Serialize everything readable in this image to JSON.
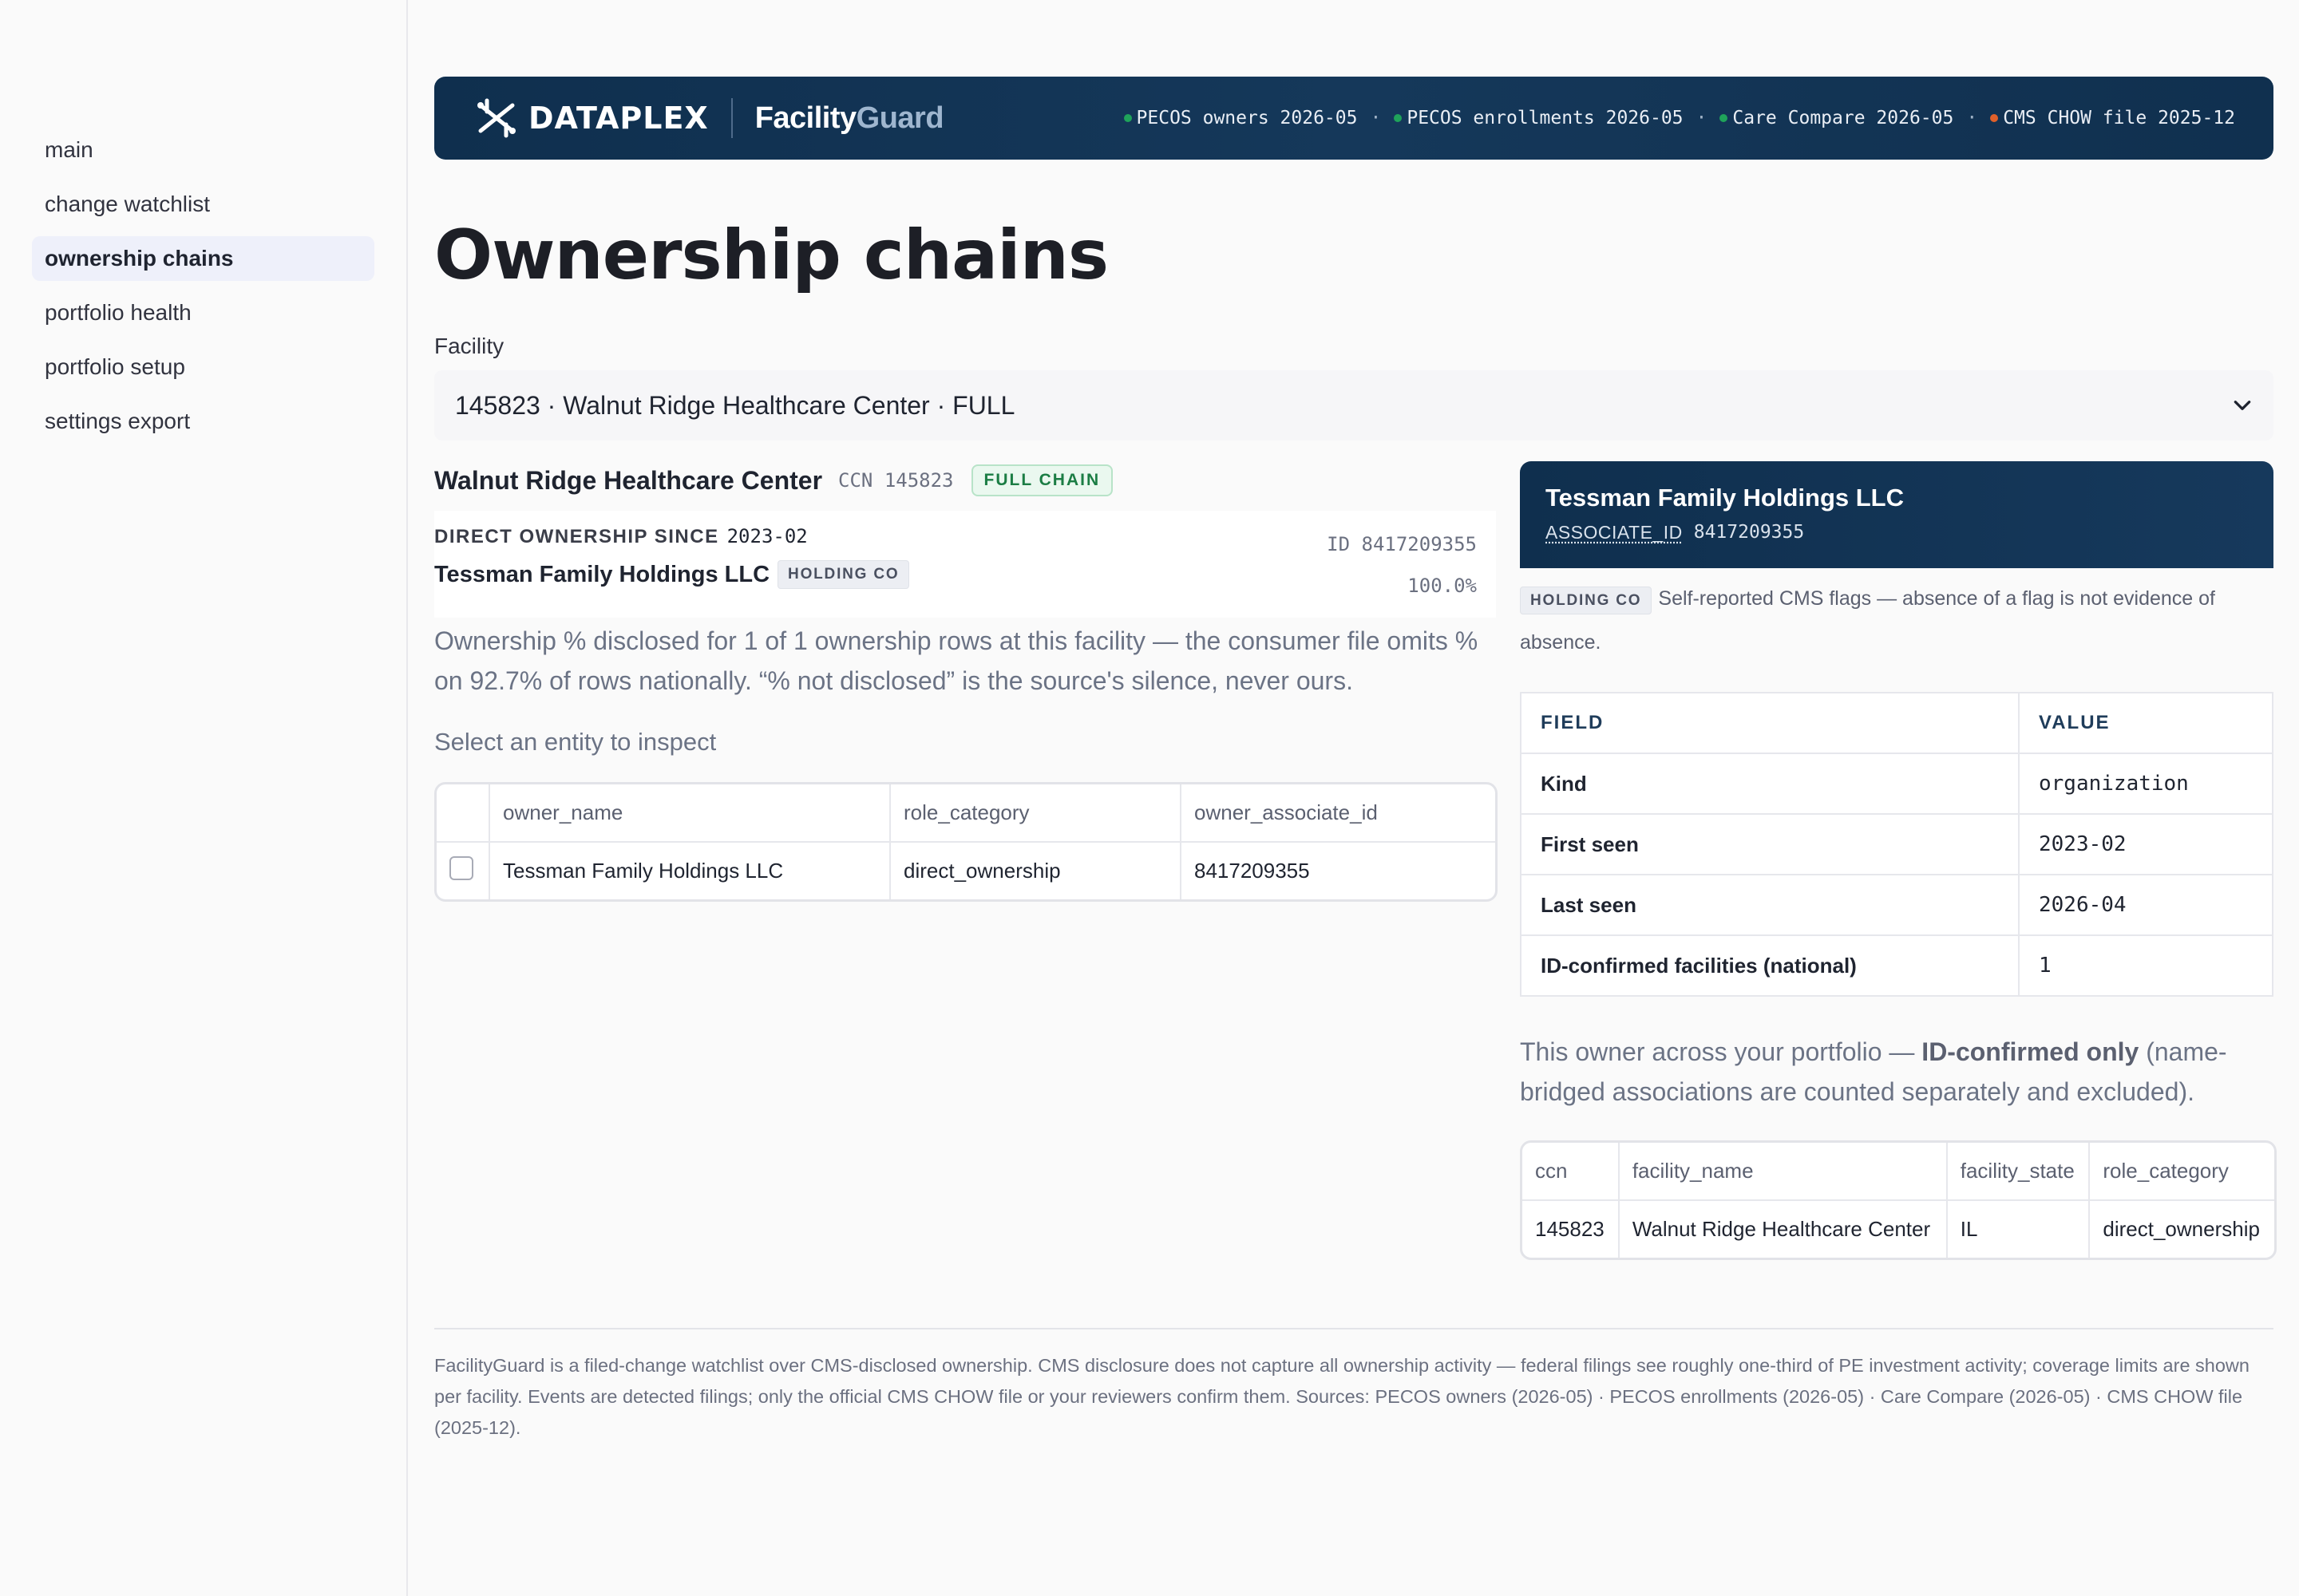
{
  "sidebar": {
    "items": [
      {
        "label": "main",
        "active": false
      },
      {
        "label": "change watchlist",
        "active": false
      },
      {
        "label": "ownership chains",
        "active": true
      },
      {
        "label": "portfolio health",
        "active": false
      },
      {
        "label": "portfolio setup",
        "active": false
      },
      {
        "label": "settings export",
        "active": false
      }
    ]
  },
  "header": {
    "brand": "DATAPLEX",
    "product_part1": "Facility",
    "product_part2": "Guard",
    "sources": [
      {
        "label": "PECOS owners 2026-05",
        "color": "#1fa35a"
      },
      {
        "label": "PECOS enrollments 2026-05",
        "color": "#1fa35a"
      },
      {
        "label": "Care Compare 2026-05",
        "color": "#1fa35a"
      },
      {
        "label": "CMS CHOW file 2025-12",
        "color": "#e0602a"
      }
    ],
    "separator": "·"
  },
  "page": {
    "title": "Ownership chains",
    "facility_label": "Facility",
    "facility_selected": "145823 · Walnut Ridge Healthcare Center · FULL"
  },
  "facility": {
    "name": "Walnut Ridge Healthcare Center",
    "ccn": "CCN 145823",
    "chain_badge": "FULL CHAIN",
    "ownership": {
      "since_label": "DIRECT OWNERSHIP SINCE",
      "since_date": "2023-02",
      "owner_name": "Tessman Family Holdings LLC",
      "kind": "HOLDING CO",
      "id": "ID 8417209355",
      "pct": "100.0%"
    },
    "disclose_note": "Ownership % disclosed for 1 of 1 ownership rows at this facility — the consumer file omits % on 92.7% of rows nationally. “% not disclosed” is the source's silence, never ours.",
    "select_hint": "Select an entity to inspect",
    "table": {
      "columns": [
        "owner_name",
        "role_category",
        "owner_associate_id"
      ],
      "rows": [
        [
          "Tessman Family Holdings LLC",
          "direct_ownership",
          "8417209355"
        ]
      ]
    }
  },
  "entity": {
    "name": "Tessman Family Holdings LLC",
    "id_key": "ASSOCIATE_ID",
    "id_value": "8417209355",
    "kind": "HOLDING CO",
    "flag_note": "Self-reported CMS flags — absence of a flag is not evidence of absence.",
    "fields_header": [
      "FIELD",
      "VALUE"
    ],
    "fields": [
      {
        "field": "Kind",
        "value": "organization"
      },
      {
        "field": "First seen",
        "value": "2023-02"
      },
      {
        "field": "Last seen",
        "value": "2026-04"
      },
      {
        "field": "ID-confirmed facilities (national)",
        "value": "1"
      }
    ],
    "portfolio_note_pre": "This owner across your portfolio — ",
    "portfolio_note_bold": "ID-confirmed only",
    "portfolio_note_post": " (name-bridged associations are counted separately and excluded).",
    "portfolio_table": {
      "columns": [
        "ccn",
        "facility_name",
        "facility_state",
        "role_category"
      ],
      "rows": [
        [
          "145823",
          "Walnut Ridge Healthcare Center",
          "IL",
          "direct_ownership"
        ]
      ]
    }
  },
  "footer": {
    "text": "FacilityGuard is a filed-change watchlist over CMS-disclosed ownership. CMS disclosure does not capture all ownership activity — federal filings see roughly one-third of PE investment activity; coverage limits are shown per facility. Events are detected filings; only the official CMS CHOW file or your reviewers confirm them. Sources: PECOS owners (2026-05) · PECOS enrollments (2026-05) · Care Compare (2026-05) · CMS CHOW file (2025-12)."
  }
}
